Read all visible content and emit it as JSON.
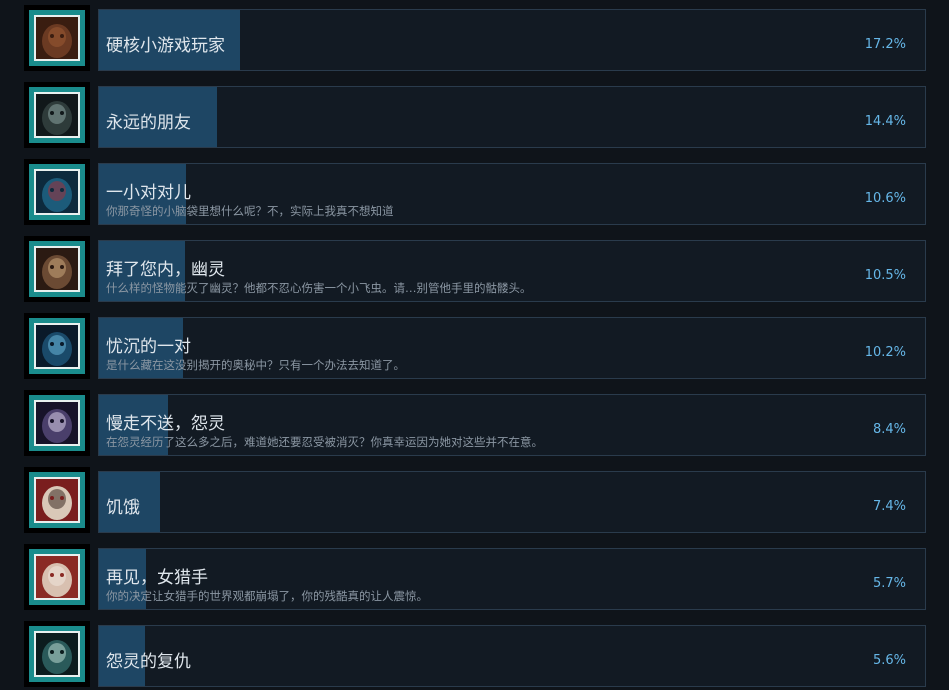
{
  "achievements": [
    {
      "title": "硬核小游戏玩家",
      "description": "",
      "percent_label": "17.2%",
      "percent": 17.2,
      "icon": "fur-creature-icon",
      "art": [
        "#6b3a22",
        "#3a1d10",
        "#9a5a33"
      ]
    },
    {
      "title": "永远的朋友",
      "description": "",
      "percent_label": "14.4%",
      "percent": 14.4,
      "icon": "ghoul-face-icon",
      "art": [
        "#2e3b3a",
        "#11181a",
        "#8aa39e"
      ]
    },
    {
      "title": "一小对对儿",
      "description": "你那奇怪的小脑袋里想什么呢？不，实际上我真不想知道",
      "percent_label": "10.6%",
      "percent": 10.6,
      "icon": "haunted-room-icon",
      "art": [
        "#1c5b7a",
        "#0d2a3d",
        "#a0303a"
      ]
    },
    {
      "title": "拜了您内，幽灵",
      "description": "什么样的怪物能灭了幽灵？他都不忍心伤害一个小飞虫。请…别管他手里的骷髅头。",
      "percent_label": "10.5%",
      "percent": 10.5,
      "icon": "werewolf-face-icon",
      "art": [
        "#6b4a33",
        "#2b1a12",
        "#c9a67a"
      ]
    },
    {
      "title": "忧沉的一对",
      "description": "是什么藏在这没别揭开的奥秘中？只有一个办法去知道了。",
      "percent_label": "10.2%",
      "percent": 10.2,
      "icon": "moonlit-scene-icon",
      "art": [
        "#1a4a6a",
        "#0a1a2a",
        "#6ab6d8"
      ]
    },
    {
      "title": "慢走不送，怨灵",
      "description": "在怨灵经历了这么多之后，难道她还要忍受被消灭？你真幸运因为她对这些并不在意。",
      "percent_label": "8.4%",
      "percent": 8.4,
      "icon": "masked-spirit-icon",
      "art": [
        "#4a3f6b",
        "#171329",
        "#d8d0e8"
      ]
    },
    {
      "title": "饥饿",
      "description": "",
      "percent_label": "7.4%",
      "percent": 7.4,
      "icon": "bloody-face-icon",
      "art": [
        "#d9c8b8",
        "#7a1e1e",
        "#3a2a22"
      ]
    },
    {
      "title": "再见，女猎手",
      "description": "你的决定让女猎手的世界观都崩塌了，你的残酷真的让人震惊。",
      "percent_label": "5.7%",
      "percent": 5.7,
      "icon": "huntress-face-icon",
      "art": [
        "#d8c0b0",
        "#8a2a24",
        "#f0e6de"
      ]
    },
    {
      "title": "怨灵的复仇",
      "description": "",
      "percent_label": "5.6%",
      "percent": 5.6,
      "icon": "vengeful-spirit-icon",
      "art": [
        "#2a5a5a",
        "#0c1c1e",
        "#b8d8d0"
      ]
    }
  ],
  "colors": {
    "background": "#0f141a",
    "card": "#121a23",
    "bar": "#1e4664",
    "percent_text": "#66b7e8",
    "icon_frame": "#1a8c8c"
  }
}
